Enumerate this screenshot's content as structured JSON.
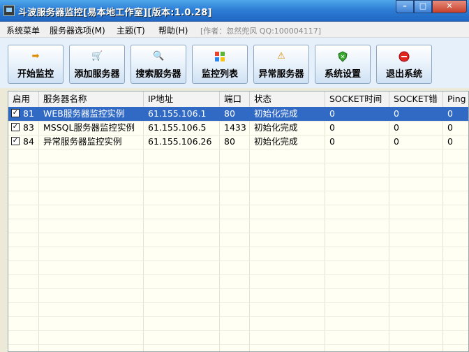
{
  "window": {
    "title": "斗波服务器监控[易本地工作室][版本:1.0.28]",
    "min": "–",
    "max": "□",
    "close": "✕"
  },
  "menu": {
    "items": [
      "系统菜单",
      "服务器选项(M)",
      "主题(T)",
      "帮助(H)"
    ],
    "note": "[作者：忽然兜风 QQ:100004117]"
  },
  "toolbar": {
    "buttons": [
      {
        "label": "开始监控",
        "icon": "arrow-icon"
      },
      {
        "label": "添加服务器",
        "icon": "cart-icon"
      },
      {
        "label": "搜索服务器",
        "icon": "magnifier-icon"
      },
      {
        "label": "监控列表",
        "icon": "windows-flag-icon"
      },
      {
        "label": "异常服务器",
        "icon": "warning-icon"
      },
      {
        "label": "系统设置",
        "icon": "shield-icon"
      },
      {
        "label": "退出系统",
        "icon": "stop-icon"
      }
    ]
  },
  "table": {
    "columns": [
      "启用",
      "服务器名称",
      "IP地址",
      "端口",
      "状态",
      "SOCKET时间",
      "SOCKET错",
      "Ping"
    ],
    "rows": [
      {
        "enabled": true,
        "id": "81",
        "name": "WEB服务器监控实例",
        "ip": "61.155.106.1",
        "port": "80",
        "status": "初始化完成",
        "socket_time": "0",
        "socket_err": "0",
        "ping": "0",
        "selected": true
      },
      {
        "enabled": true,
        "id": "83",
        "name": "MSSQL服务器监控实例",
        "ip": "61.155.106.5",
        "port": "1433",
        "status": "初始化完成",
        "socket_time": "0",
        "socket_err": "0",
        "ping": "0",
        "selected": false
      },
      {
        "enabled": true,
        "id": "84",
        "name": "异常服务器监控实例",
        "ip": "61.155.106.26",
        "port": "80",
        "status": "初始化完成",
        "socket_time": "0",
        "socket_err": "0",
        "ping": "0",
        "selected": false
      }
    ]
  }
}
